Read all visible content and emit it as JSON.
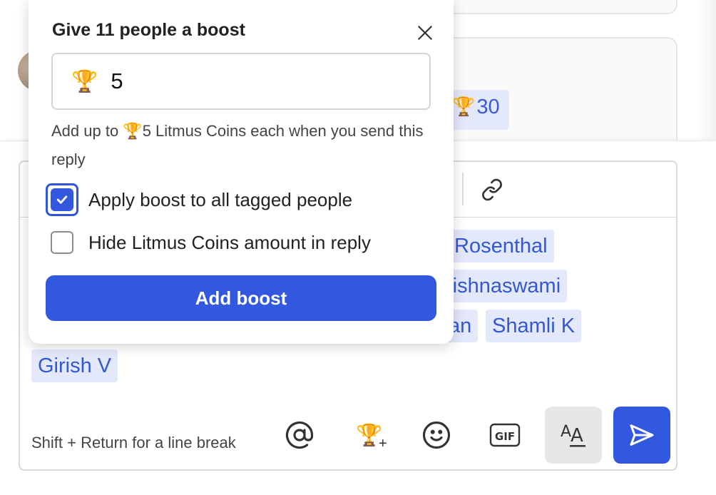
{
  "thread": {
    "reaction_amount": "30",
    "reaction_icon": "trophy-icon"
  },
  "composer": {
    "tags": [
      "Rosenthal",
      "rishnaswami",
      "an",
      "Shamli K",
      "Girish V"
    ],
    "hint": "Shift + Return for a line break",
    "toolbar_icons": [
      "at-mention-icon",
      "trophy-add-icon",
      "emoji-icon",
      "gif-icon",
      "text-format-icon",
      "send-icon",
      "link-icon"
    ]
  },
  "boost_popover": {
    "title": "Give 11 people a boost",
    "amount_value": "5",
    "helper_text": "Add up to 🏆5 Litmus Coins each when you send this reply",
    "apply_all_label": "Apply boost to all tagged people",
    "apply_all_checked": true,
    "hide_amount_label": "Hide Litmus Coins amount in reply",
    "hide_amount_checked": false,
    "submit_label": "Add boost"
  },
  "colors": {
    "accent": "#3358e0",
    "tag_bg": "#e3e9fb",
    "tag_text": "#3358d4"
  }
}
